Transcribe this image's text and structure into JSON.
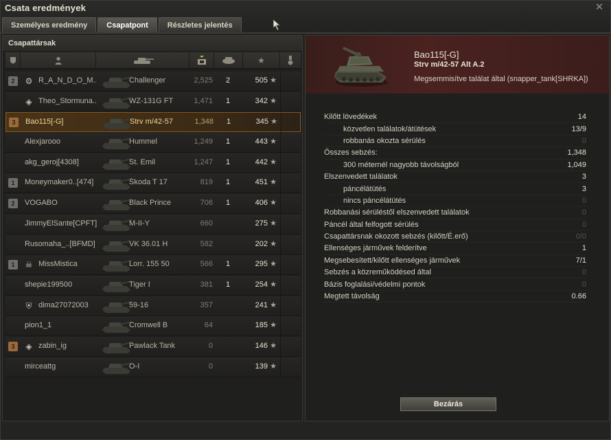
{
  "window": {
    "title": "Csata eredmények"
  },
  "tabs": [
    {
      "label": "Személyes eredmény",
      "active": false
    },
    {
      "label": "Csapatpont",
      "active": true
    },
    {
      "label": "Részletes jelentés",
      "active": false
    }
  ],
  "team": {
    "heading": "Csapattársak",
    "columns": [
      "squad-icon",
      "player-icon",
      "tank-icon",
      "damage-sort-icon",
      "kills-icon",
      "xp-star-icon",
      "medal-icon"
    ],
    "rows": [
      {
        "badge": "2",
        "badge_style": "silver",
        "clan_icon": "clan-emblem-icon",
        "name": "R_A_N_D_O_M..",
        "tank": "Challenger",
        "damage": "2,525",
        "kills": "2",
        "xp": "505",
        "self": false
      },
      {
        "badge": "",
        "badge_style": "",
        "clan_icon": "diamond-emblem-icon",
        "name": "Theo_Stormuna..",
        "tank": "WZ-131G FT",
        "damage": "1,471",
        "kills": "1",
        "xp": "342",
        "self": false
      },
      {
        "badge": "3",
        "badge_style": "bronze",
        "clan_icon": "",
        "name": "Bao115[-G]",
        "tank": "Strv m/42-57",
        "damage": "1,348",
        "kills": "1",
        "xp": "345",
        "self": true
      },
      {
        "badge": "",
        "badge_style": "",
        "clan_icon": "",
        "name": "Alexjarooo",
        "tank": "Hummel",
        "damage": "1,249",
        "kills": "1",
        "xp": "443",
        "self": false
      },
      {
        "badge": "",
        "badge_style": "",
        "clan_icon": "",
        "name": "akg_geroj[4308]",
        "tank": "St. Emil",
        "damage": "1,247",
        "kills": "1",
        "xp": "442",
        "self": false
      },
      {
        "badge": "1",
        "badge_style": "silver",
        "clan_icon": "",
        "name": "Moneymaker0..[474]",
        "tank": "Škoda T 17",
        "damage": "819",
        "kills": "1",
        "xp": "451",
        "self": false
      },
      {
        "badge": "2",
        "badge_style": "silver",
        "clan_icon": "",
        "name": "VOGABO",
        "tank": "Black Prince",
        "damage": "706",
        "kills": "1",
        "xp": "406",
        "self": false
      },
      {
        "badge": "",
        "badge_style": "",
        "clan_icon": "",
        "name": "JimmyElSante[CPFT]",
        "tank": "M-II-Y",
        "damage": "660",
        "kills": "",
        "xp": "275",
        "self": false
      },
      {
        "badge": "",
        "badge_style": "",
        "clan_icon": "",
        "name": "Rusomaha_..[BFMD]",
        "tank": "VK 36.01 H",
        "damage": "582",
        "kills": "",
        "xp": "202",
        "self": false
      },
      {
        "badge": "1",
        "badge_style": "silver",
        "clan_icon": "skull-emblem-icon",
        "name": "MissMistica",
        "tank": "Lorr. 155 50",
        "damage": "566",
        "kills": "1",
        "xp": "295",
        "self": false
      },
      {
        "badge": "",
        "badge_style": "",
        "clan_icon": "",
        "name": "shepie199500",
        "tank": "Tiger I",
        "damage": "381",
        "kills": "1",
        "xp": "254",
        "self": false
      },
      {
        "badge": "",
        "badge_style": "",
        "clan_icon": "shield-emblem-icon",
        "name": "dima27072003",
        "tank": "59-16",
        "damage": "357",
        "kills": "",
        "xp": "241",
        "self": false
      },
      {
        "badge": "",
        "badge_style": "",
        "clan_icon": "",
        "name": "pion1_1",
        "tank": "Cromwell B",
        "damage": "64",
        "kills": "",
        "xp": "185",
        "self": false
      },
      {
        "badge": "3",
        "badge_style": "bronze",
        "clan_icon": "diamond-emblem-icon",
        "name": "zabin_ig",
        "tank": "Pawlack Tank",
        "damage": "0",
        "kills": "",
        "xp": "146",
        "self": false
      },
      {
        "badge": "",
        "badge_style": "",
        "clan_icon": "",
        "name": "mirceattg",
        "tank": "O-I",
        "damage": "0",
        "kills": "",
        "xp": "139",
        "self": false
      }
    ]
  },
  "detail": {
    "player": "Bao115[-G]",
    "tank": "Strv m/42-57 Alt A.2",
    "status": "Megsemmisítve találat által (snapper_tank[SHRKA])",
    "stats": [
      {
        "label": "Kilőtt lövedékek",
        "value": "14",
        "sub": false
      },
      {
        "label": "közvetlen találatok/átütések",
        "value": "13/9",
        "sub": true
      },
      {
        "label": "robbanás okozta sérülés",
        "value": "0",
        "sub": true
      },
      {
        "label": "Összes sebzés:",
        "value": "1,348",
        "sub": false
      },
      {
        "label": "300 méternél nagyobb távolságból",
        "value": "1,049",
        "sub": true
      },
      {
        "label": "Elszenvedett találatok",
        "value": "3",
        "sub": false
      },
      {
        "label": "páncélátütés",
        "value": "3",
        "sub": true
      },
      {
        "label": "nincs páncélátütés",
        "value": "0",
        "sub": true
      },
      {
        "label": "Robbanási sérüléstől elszenvedett találatok",
        "value": "0",
        "sub": false
      },
      {
        "label": "Páncél által felfogott sérülés",
        "value": "0",
        "sub": false
      },
      {
        "label": "Csapattársnak okozott sebzés (kilőtt/É.erő)",
        "value": "0/0",
        "sub": false
      },
      {
        "label": "Ellenséges járművek felderítve",
        "value": "1",
        "sub": false
      },
      {
        "label": "Megsebesített/kilőtt ellenséges járművek",
        "value": "7/1",
        "sub": false
      },
      {
        "label": "Sebzés a közreműködésed által",
        "value": "0",
        "sub": false
      },
      {
        "label": "Bázis foglalási/védelmi pontok",
        "value": "0",
        "sub": false
      },
      {
        "label": "Megtett távolság",
        "value": "0.66",
        "sub": false
      }
    ],
    "close_label": "Bezárás"
  }
}
